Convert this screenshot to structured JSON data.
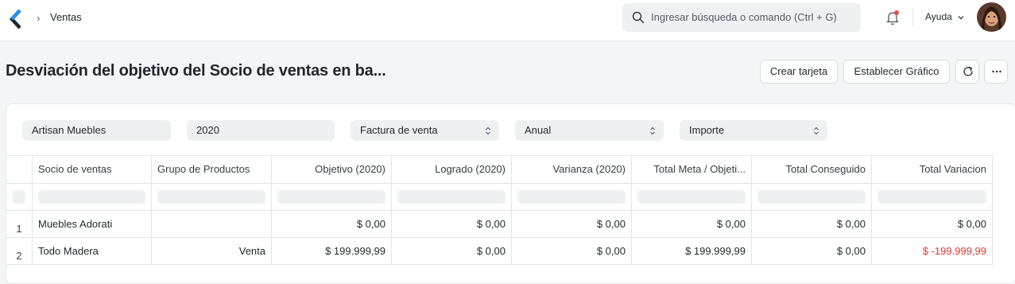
{
  "navbar": {
    "breadcrumb": "Ventas",
    "search_placeholder": "Ingresar búsqueda o comando (Ctrl + G)",
    "help_label": "Ayuda"
  },
  "page": {
    "title": "Desviación del objetivo del Socio de ventas en ba...",
    "buttons": {
      "create_card": "Crear tarjeta",
      "set_chart": "Establecer Gráfico"
    }
  },
  "filters": {
    "company": "Artisan Muebles",
    "year": "2020",
    "based_on": "Factura de venta",
    "period": "Anual",
    "target_on": "Importe"
  },
  "table": {
    "columns": [
      "Socio de ventas",
      "Grupo de Productos",
      "Objetivo (2020)",
      "Logrado (2020)",
      "Varianza (2020)",
      "Total Meta / Objeti...",
      "Total Conseguido",
      "Total Variacion"
    ],
    "rows": [
      {
        "index": "1",
        "partner": "Muebles Adorati",
        "group": "",
        "target": "$ 0,00",
        "achieved": "$ 0,00",
        "variance": "$ 0,00",
        "total_target": "$ 0,00",
        "total_achieved": "$ 0,00",
        "total_variance": "$ 0,00"
      },
      {
        "index": "2",
        "partner": "Todo Madera",
        "group": "Venta",
        "target": "$ 199.999,99",
        "achieved": "$ 0,00",
        "variance": "$ 0,00",
        "total_target": "$ 199.999,99",
        "total_achieved": "$ 0,00",
        "total_variance": "$ -199.999,99"
      }
    ]
  },
  "colors": {
    "brand": "#2490ef",
    "negative": "#e03636"
  }
}
